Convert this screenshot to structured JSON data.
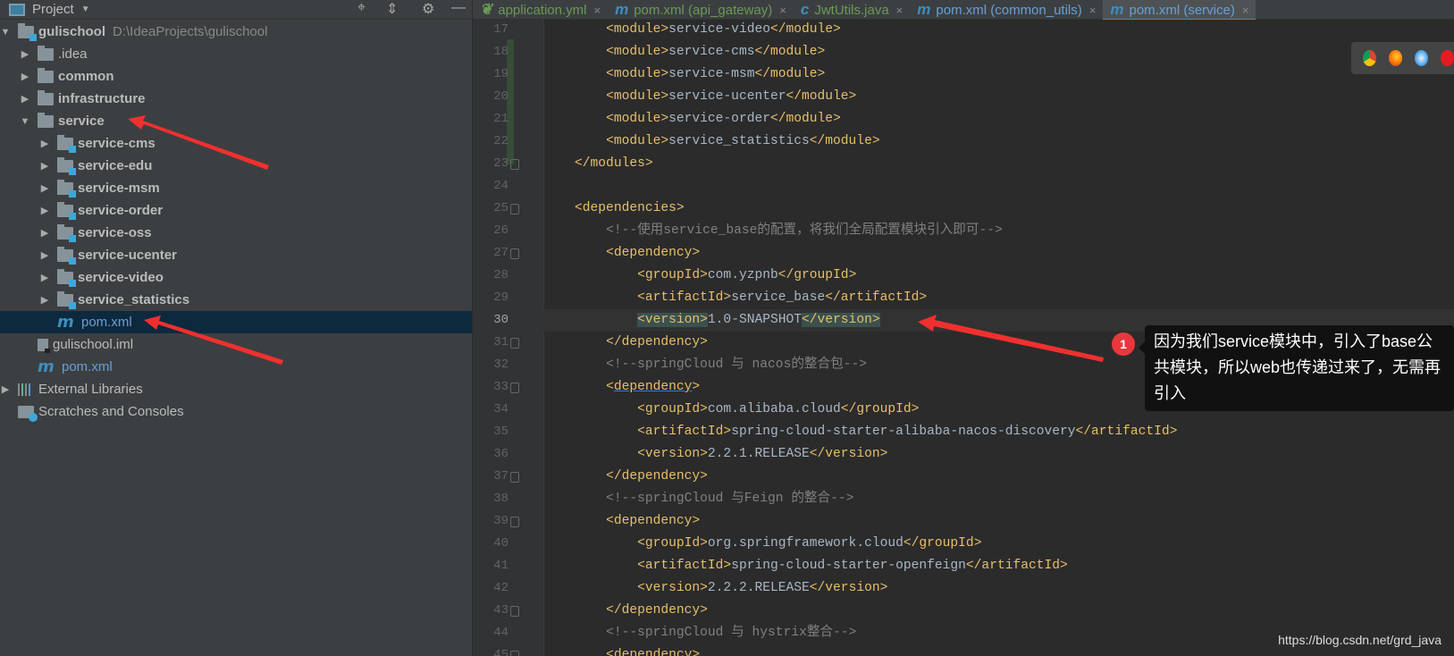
{
  "sidebar": {
    "title": "Project",
    "toolbar_icons": [
      "locate-icon",
      "collapse-icon",
      "gear-icon",
      "minimize-icon"
    ],
    "items": [
      {
        "label": "gulischool",
        "path": "D:\\IdeaProjects\\gulischool",
        "level": 0,
        "arrow": "down",
        "icon": "module-folder",
        "bold": true
      },
      {
        "label": ".idea",
        "level": 1,
        "arrow": "right",
        "icon": "folder"
      },
      {
        "label": "common",
        "level": 1,
        "arrow": "right",
        "icon": "folder",
        "bold": true
      },
      {
        "label": "infrastructure",
        "level": 1,
        "arrow": "right",
        "icon": "folder",
        "bold": true
      },
      {
        "label": "service",
        "level": 1,
        "arrow": "down",
        "icon": "folder",
        "bold": true
      },
      {
        "label": "service-cms",
        "level": 2,
        "arrow": "right",
        "icon": "module-folder",
        "bold": true
      },
      {
        "label": "service-edu",
        "level": 2,
        "arrow": "right",
        "icon": "module-folder",
        "bold": true
      },
      {
        "label": "service-msm",
        "level": 2,
        "arrow": "right",
        "icon": "module-folder",
        "bold": true
      },
      {
        "label": "service-order",
        "level": 2,
        "arrow": "right",
        "icon": "module-folder",
        "bold": true
      },
      {
        "label": "service-oss",
        "level": 2,
        "arrow": "right",
        "icon": "module-folder",
        "bold": true
      },
      {
        "label": "service-ucenter",
        "level": 2,
        "arrow": "right",
        "icon": "module-folder",
        "bold": true
      },
      {
        "label": "service-video",
        "level": 2,
        "arrow": "right",
        "icon": "module-folder",
        "bold": true
      },
      {
        "label": "service_statistics",
        "level": 2,
        "arrow": "right",
        "icon": "module-folder",
        "bold": true
      },
      {
        "label": "pom.xml",
        "level": 2,
        "arrow": "",
        "icon": "maven",
        "selected": true,
        "blue": true
      },
      {
        "label": "gulischool.iml",
        "level": 1,
        "arrow": "",
        "icon": "file"
      },
      {
        "label": "pom.xml",
        "level": 1,
        "arrow": "",
        "icon": "maven",
        "blue": true
      },
      {
        "label": "External Libraries",
        "level": 0,
        "arrow": "right",
        "icon": "libraries"
      },
      {
        "label": "Scratches and Consoles",
        "level": 0,
        "arrow": "",
        "icon": "scratches"
      }
    ]
  },
  "tabs": [
    {
      "label": "application.yml",
      "icon": "spring-icon",
      "color": "#6a9955",
      "active": false
    },
    {
      "label": "pom.xml (api_gateway)",
      "icon": "maven-icon",
      "color": "#6a9955",
      "active": false
    },
    {
      "label": "JwtUtils.java",
      "icon": "class-icon",
      "color": "#6a9955",
      "active": false
    },
    {
      "label": "pom.xml (common_utils)",
      "icon": "maven-icon",
      "color": "#6a9fd4",
      "active": false
    },
    {
      "label": "pom.xml (service)",
      "icon": "maven-icon",
      "color": "#6a9fd4",
      "active": true
    }
  ],
  "tab_close": "×",
  "editor": {
    "current_line": 30,
    "lines": [
      {
        "n": 17,
        "t": [
          [
            "s",
            "        "
          ],
          [
            "tag",
            "<module>"
          ],
          [
            "txt",
            "service-video"
          ],
          [
            "tag",
            "</module>"
          ]
        ]
      },
      {
        "n": 18,
        "t": [
          [
            "s",
            "        "
          ],
          [
            "tag",
            "<module>"
          ],
          [
            "txt",
            "service-cms"
          ],
          [
            "tag",
            "</module>"
          ]
        ]
      },
      {
        "n": 19,
        "t": [
          [
            "s",
            "        "
          ],
          [
            "tag",
            "<module>"
          ],
          [
            "txt",
            "service-msm"
          ],
          [
            "tag",
            "</module>"
          ]
        ]
      },
      {
        "n": 20,
        "t": [
          [
            "s",
            "        "
          ],
          [
            "tag",
            "<module>"
          ],
          [
            "txt",
            "service-ucenter"
          ],
          [
            "tag",
            "</module>"
          ]
        ]
      },
      {
        "n": 21,
        "t": [
          [
            "s",
            "        "
          ],
          [
            "tag",
            "<module>"
          ],
          [
            "txt",
            "service-order"
          ],
          [
            "tag",
            "</module>"
          ]
        ]
      },
      {
        "n": 22,
        "t": [
          [
            "s",
            "        "
          ],
          [
            "tag",
            "<module>"
          ],
          [
            "txt",
            "service_statistics"
          ],
          [
            "tag",
            "</module>"
          ]
        ]
      },
      {
        "n": 23,
        "t": [
          [
            "s",
            "    "
          ],
          [
            "tag",
            "</modules>"
          ]
        ]
      },
      {
        "n": 24,
        "t": []
      },
      {
        "n": 25,
        "t": [
          [
            "s",
            "    "
          ],
          [
            "tag",
            "<dependencies>"
          ]
        ]
      },
      {
        "n": 26,
        "t": [
          [
            "s",
            "        "
          ],
          [
            "com",
            "<!--使用service_base的配置，将我们全局配置模块引入即可-->"
          ]
        ]
      },
      {
        "n": 27,
        "t": [
          [
            "s",
            "        "
          ],
          [
            "tag",
            "<dependency>"
          ]
        ]
      },
      {
        "n": 28,
        "t": [
          [
            "s",
            "            "
          ],
          [
            "tag",
            "<groupId>"
          ],
          [
            "txt",
            "com.yzpnb"
          ],
          [
            "tag",
            "</groupId>"
          ]
        ]
      },
      {
        "n": 29,
        "t": [
          [
            "s",
            "            "
          ],
          [
            "tag",
            "<artifactId>"
          ],
          [
            "txt",
            "service_base"
          ],
          [
            "tag",
            "</artifactId>"
          ]
        ]
      },
      {
        "n": 30,
        "t": [
          [
            "s",
            "            "
          ],
          [
            "hl",
            "<version>"
          ],
          [
            "txt",
            "1.0-SNAPSHOT"
          ],
          [
            "hl",
            "</version>"
          ]
        ]
      },
      {
        "n": 31,
        "t": [
          [
            "s",
            "        "
          ],
          [
            "tag",
            "</dependency>"
          ]
        ]
      },
      {
        "n": 32,
        "t": [
          [
            "s",
            "        "
          ],
          [
            "com",
            "<!--springCloud 与 nacos的整合包-->"
          ]
        ]
      },
      {
        "n": 33,
        "t": [
          [
            "s",
            "        "
          ],
          [
            "tag",
            "<"
          ],
          [
            "link",
            "dependency"
          ],
          [
            "tag",
            ">"
          ]
        ]
      },
      {
        "n": 34,
        "t": [
          [
            "s",
            "            "
          ],
          [
            "tag",
            "<groupId>"
          ],
          [
            "txt",
            "com.alibaba.cloud"
          ],
          [
            "tag",
            "</groupId>"
          ]
        ]
      },
      {
        "n": 35,
        "t": [
          [
            "s",
            "            "
          ],
          [
            "tag",
            "<artifactId>"
          ],
          [
            "txt",
            "spring-cloud-starter-alibaba-nacos-discovery"
          ],
          [
            "tag",
            "</artifactId>"
          ]
        ]
      },
      {
        "n": 36,
        "t": [
          [
            "s",
            "            "
          ],
          [
            "tag",
            "<version>"
          ],
          [
            "txt",
            "2.2.1.RELEASE"
          ],
          [
            "tag",
            "</version>"
          ]
        ]
      },
      {
        "n": 37,
        "t": [
          [
            "s",
            "        "
          ],
          [
            "tag",
            "</dependency>"
          ]
        ]
      },
      {
        "n": 38,
        "t": [
          [
            "s",
            "        "
          ],
          [
            "com",
            "<!--springCloud 与Feign 的整合-->"
          ]
        ]
      },
      {
        "n": 39,
        "t": [
          [
            "s",
            "        "
          ],
          [
            "tag",
            "<dependency>"
          ]
        ]
      },
      {
        "n": 40,
        "t": [
          [
            "s",
            "            "
          ],
          [
            "tag",
            "<groupId>"
          ],
          [
            "txt",
            "org.springframework.cloud"
          ],
          [
            "tag",
            "</groupId>"
          ]
        ]
      },
      {
        "n": 41,
        "t": [
          [
            "s",
            "            "
          ],
          [
            "tag",
            "<artifactId>"
          ],
          [
            "txt",
            "spring-cloud-starter-openfeign"
          ],
          [
            "tag",
            "</artifactId>"
          ]
        ]
      },
      {
        "n": 42,
        "t": [
          [
            "s",
            "            "
          ],
          [
            "tag",
            "<version>"
          ],
          [
            "txt",
            "2.2.2.RELEASE"
          ],
          [
            "tag",
            "</version>"
          ]
        ]
      },
      {
        "n": 43,
        "t": [
          [
            "s",
            "        "
          ],
          [
            "tag",
            "</dependency>"
          ]
        ]
      },
      {
        "n": 44,
        "t": [
          [
            "s",
            "        "
          ],
          [
            "com",
            "<!--springCloud 与 hystrix整合-->"
          ]
        ]
      },
      {
        "n": 45,
        "t": [
          [
            "s",
            "        "
          ],
          [
            "tag",
            "<dependency>"
          ]
        ]
      }
    ]
  },
  "browsers": [
    "chrome-icon",
    "firefox-icon",
    "safari-icon",
    "opera-icon"
  ],
  "annotation": {
    "badge": "1",
    "text": "因为我们service模块中，引入了base公共模块，所以web也传递过来了，无需再引入",
    "color": "#e8383d"
  },
  "watermark": "https://blog.csdn.net/grd_java"
}
